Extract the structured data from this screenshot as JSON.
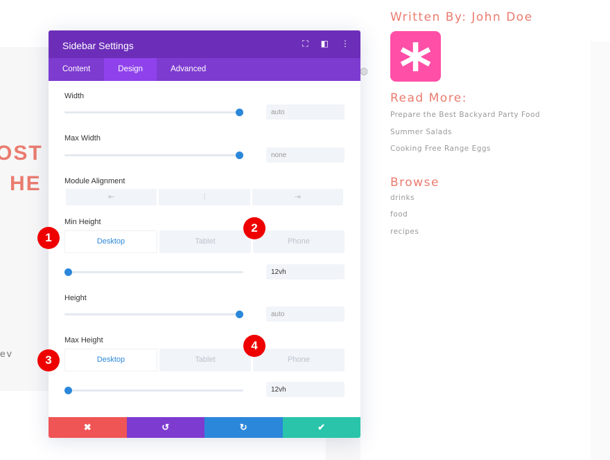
{
  "background": {
    "hero_line1": "OST",
    "hero_line2": "HE",
    "snippet": "ev"
  },
  "sidebar": {
    "author": "Written By: John Doe",
    "avatar_glyph": "*",
    "read_more_title": "Read More:",
    "read_more": [
      "Prepare the Best Backyard Party Food",
      "Summer Salads",
      "Cooking Free Range Eggs"
    ],
    "browse_title": "Browse",
    "browse": [
      "drinks",
      "food",
      "recipes"
    ]
  },
  "modal": {
    "title": "Sidebar Settings",
    "tabs": [
      "Content",
      "Design",
      "Advanced"
    ],
    "width": {
      "label": "Width",
      "value": "auto",
      "slider": 1.0
    },
    "max_width": {
      "label": "Max Width",
      "value": "none",
      "slider": 1.0
    },
    "alignment": {
      "label": "Module Alignment",
      "options": [
        "⇤",
        "⁞",
        "⇥"
      ]
    },
    "min_height": {
      "label": "Min Height",
      "devices": [
        "Desktop",
        "Tablet",
        "Phone"
      ],
      "value": "12vh",
      "slider": 0
    },
    "height": {
      "label": "Height",
      "value": "auto",
      "slider": 1.0
    },
    "max_height": {
      "label": "Max Height",
      "devices": [
        "Desktop",
        "Tablet",
        "Phone"
      ],
      "value": "12vh",
      "slider": 0
    },
    "footer": {
      "cancel": "✖",
      "undo": "↺",
      "redo": "↻",
      "save": "✔"
    }
  },
  "badges": [
    "1",
    "2",
    "3",
    "4"
  ],
  "colors": {
    "header": "#6c2eb9",
    "tabs": "#7e3bd0",
    "accent": "#2b87da",
    "cancel": "#ef5555",
    "undo": "#7e3bd0",
    "redo": "#2b87da",
    "save": "#29c4a9",
    "badge": "#ee0000"
  }
}
